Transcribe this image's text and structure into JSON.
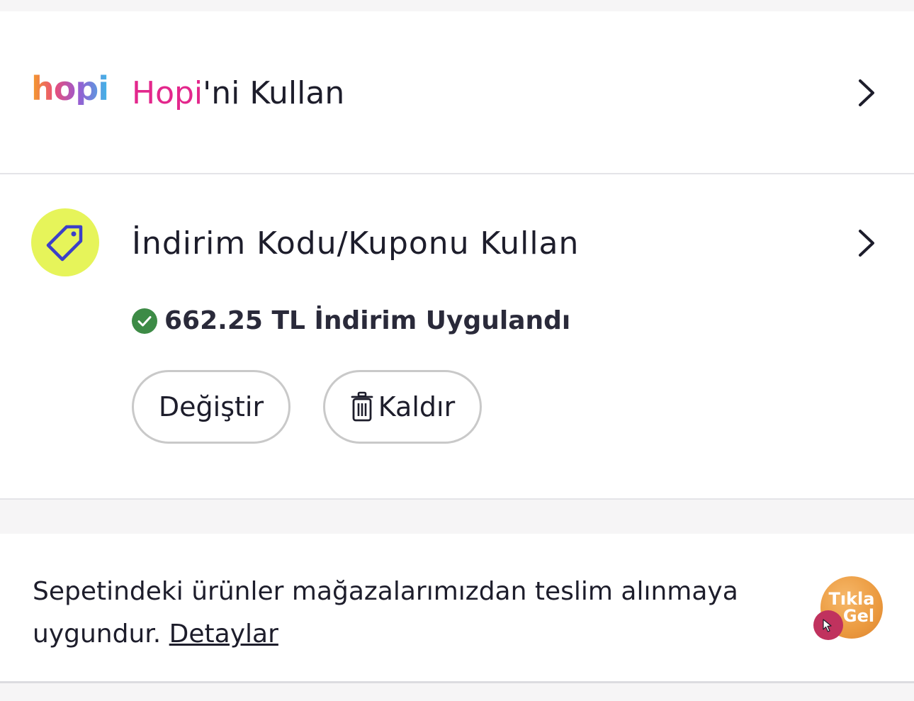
{
  "hopi": {
    "logo_text": "hopi",
    "title_brand": "Hopi",
    "title_rest": "'ni Kullan"
  },
  "coupon": {
    "title": "İndirim Kodu/Kuponu Kullan",
    "applied_text": "662.25 TL İndirim Uygulandı",
    "change_label": "Değiştir",
    "remove_label": "Kaldır"
  },
  "pickup": {
    "text": "Sepetindeki ürünler mağazalarımızdan teslim alınmaya uygundur.",
    "link_label": "Detaylar",
    "badge_line1": "Tıkla",
    "badge_line2": "Gel"
  },
  "icons": [
    "hopi-logo",
    "chevron-right-icon",
    "tag-icon",
    "check-circle-icon",
    "trash-icon",
    "tikla-gel-badge",
    "pointer-hand-icon"
  ],
  "colors": {
    "hopi_pink": "#e3278c",
    "tag_circle": "#e6f45a",
    "tag_icon": "#3b3fc9",
    "success_green": "#3d8b46",
    "badge_orange": "#eb9a3f",
    "badge_hand": "#c0325e"
  }
}
